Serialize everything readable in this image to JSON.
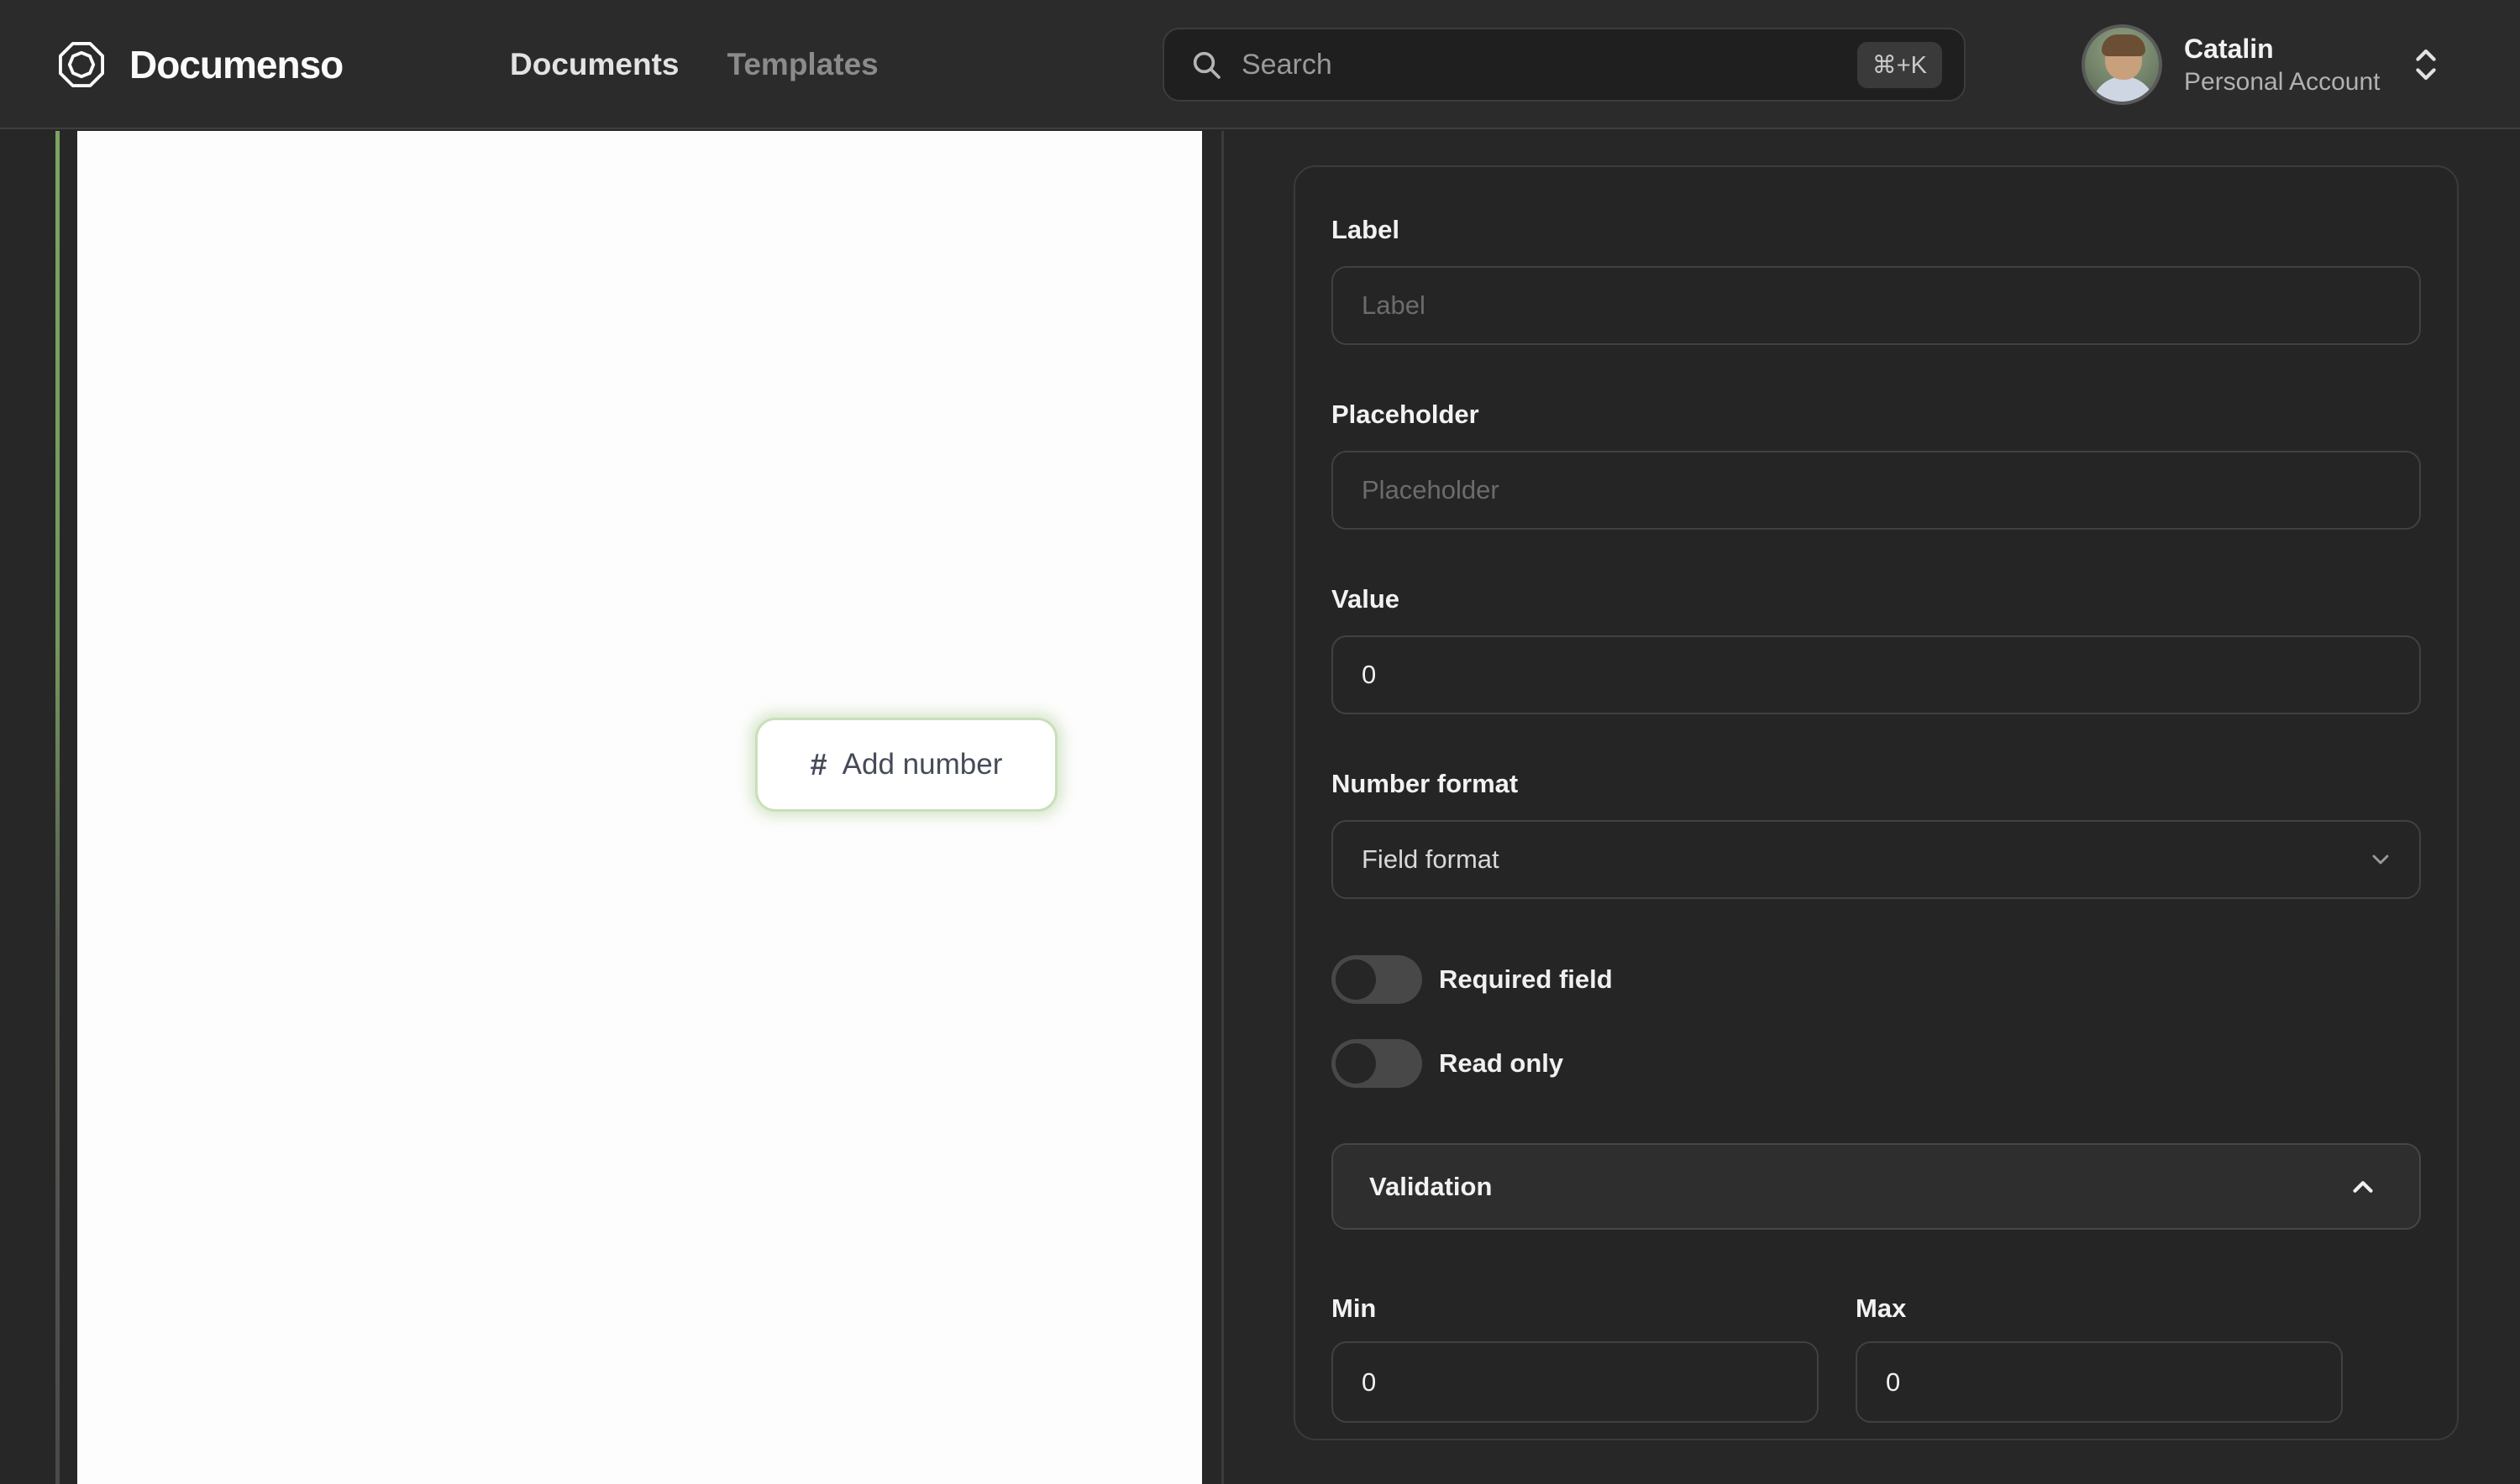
{
  "navbar": {
    "brand": "Documenso",
    "links": [
      {
        "label": "Documents"
      },
      {
        "label": "Templates"
      }
    ],
    "search": {
      "placeholder": "Search",
      "shortcut": "⌘+K"
    },
    "account": {
      "name": "Catalin",
      "type": "Personal Account"
    }
  },
  "document": {
    "hash_glyph": "#",
    "add_number_label": "Add number"
  },
  "panel": {
    "label_field": {
      "heading": "Label",
      "placeholder": "Label",
      "value": ""
    },
    "placeholder_field": {
      "heading": "Placeholder",
      "placeholder": "Placeholder",
      "value": ""
    },
    "value_field": {
      "heading": "Value",
      "value": "0"
    },
    "number_format": {
      "heading": "Number format",
      "selected": "Field format"
    },
    "toggles": [
      {
        "label": "Required field",
        "state": "off"
      },
      {
        "label": "Read only",
        "state": "off"
      }
    ],
    "validation": {
      "heading": "Validation",
      "expanded": "true"
    },
    "min_field": {
      "heading": "Min",
      "value": "0"
    },
    "max_field": {
      "heading": "Max",
      "value": "0"
    }
  },
  "colors": {
    "accent_green": "#7ba45f",
    "button_border_green": "#c9e0b9",
    "button_text": "#454b58",
    "navbar_bg": "#2b2b2b",
    "panel_bg": "#252525"
  }
}
